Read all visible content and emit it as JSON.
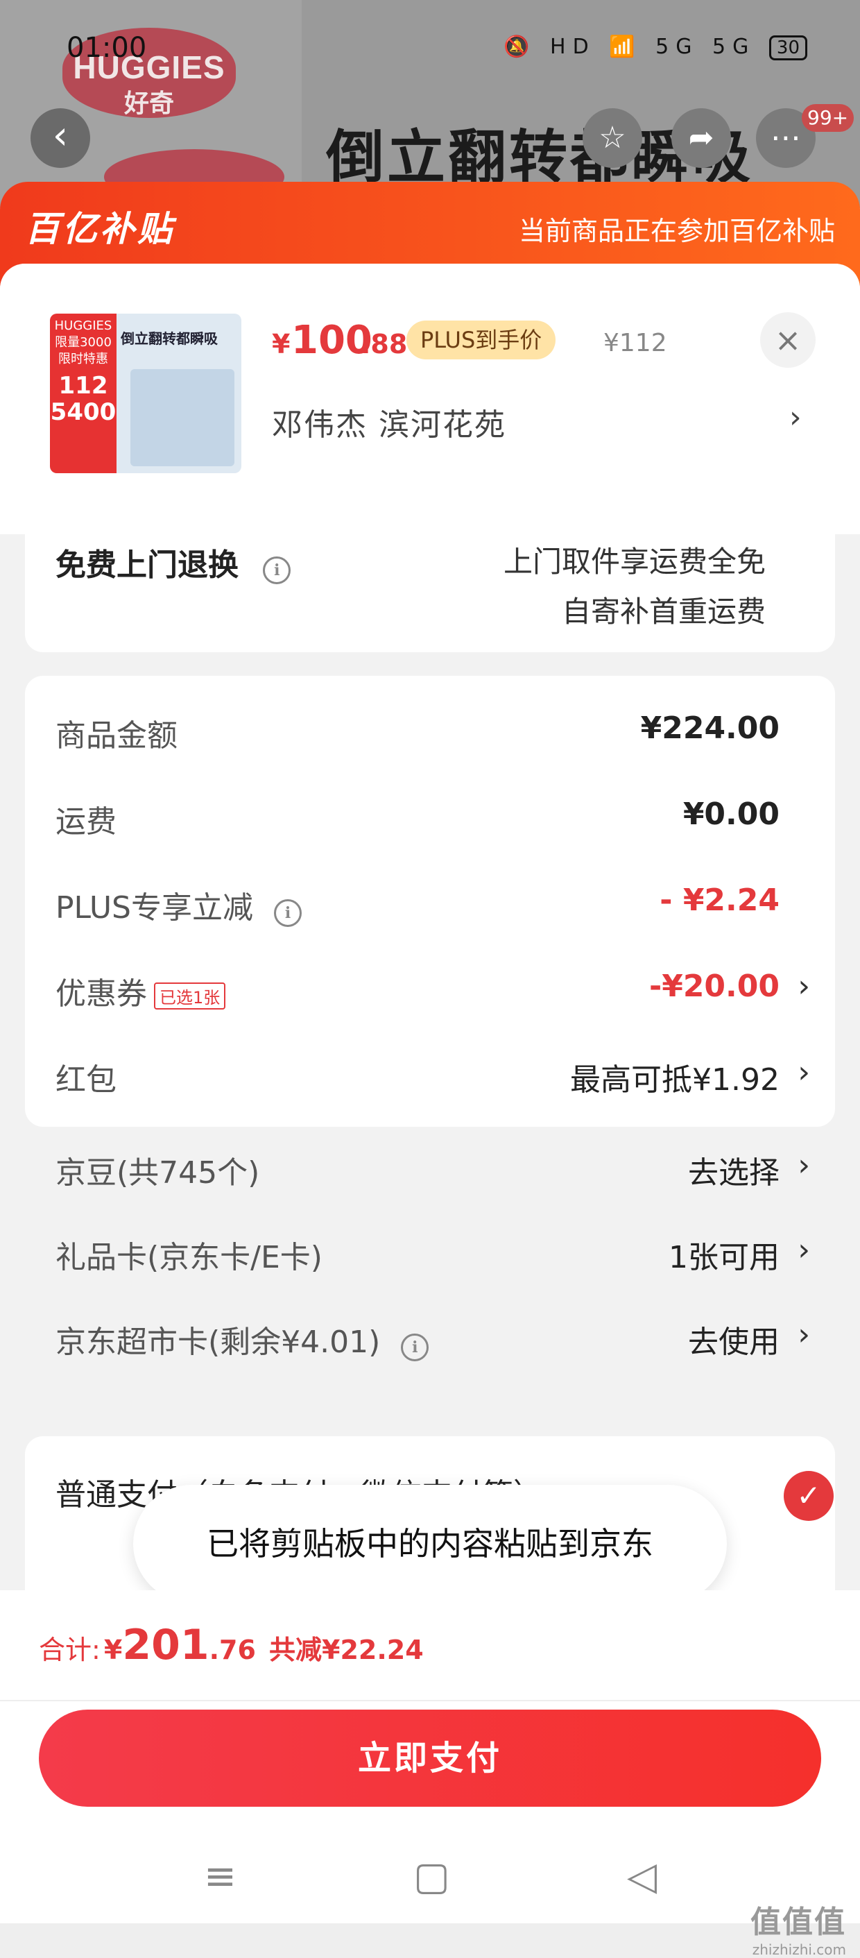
{
  "status_bar": {
    "time": "01:00",
    "icons": "🔕 HD 📶 5G 5G",
    "battery": "30"
  },
  "background": {
    "brand_logo": "HUGGIES",
    "brand_logo_cn": "好奇",
    "headline": "倒立翻转都瞬吸",
    "cart_badge": "99+"
  },
  "subsidy": {
    "logo": "百亿补贴",
    "note": "当前商品正在参加百亿补贴"
  },
  "product": {
    "thumb": {
      "brand": "HUGGIES",
      "limit": "限量3000",
      "flash": "限时特惠",
      "price": "112",
      "bottom": "5400",
      "title": "倒立翻转都瞬吸"
    },
    "price_currency": "¥",
    "price_int": "100",
    "price_dec": ".88",
    "plus_tag": "PLUS到手价",
    "original_price": "¥112",
    "address": "邓伟杰  滨河花苑"
  },
  "return_card": {
    "title": "免费上门退换",
    "line1": "上门取件享运费全免",
    "line2": "自寄补首重运费"
  },
  "summary": [
    {
      "label": "商品金额",
      "value": "¥224.00"
    },
    {
      "label": "运费",
      "value": "¥0.00"
    },
    {
      "label": "PLUS专享立减",
      "value": "- ¥2.24"
    },
    {
      "label": "优惠券",
      "tag": "已选1张",
      "value": "-¥20.00"
    },
    {
      "label": "红包",
      "value": "最高可抵¥1.92"
    },
    {
      "label": "京豆(共745个)",
      "value": "去选择"
    },
    {
      "label": "礼品卡(京东卡/E卡)",
      "value": "1张可用"
    },
    {
      "label": "京东超市卡(剩余¥4.01)",
      "value": "去使用"
    }
  ],
  "payment": {
    "label": "普通支付（白条支付、微信支付等）"
  },
  "toast": {
    "text": "已将剪贴板中的内容粘贴到京东"
  },
  "footer": {
    "total_label": "合计:",
    "total_currency": "¥",
    "total_int": "201",
    "total_dec": ".76",
    "savings": "共减¥22.24",
    "pay_button": "立即支付"
  },
  "nav": {
    "menu": "≡",
    "home": "▢",
    "back": "◁"
  },
  "watermark": {
    "name": "值值值",
    "url": "zhizhizhi.com"
  },
  "colors": {
    "accent": "#e4393c",
    "subsidy_start": "#f03a1c",
    "subsidy_end": "#ff6a1c",
    "plus_tag_bg": "#ffe3a6"
  }
}
